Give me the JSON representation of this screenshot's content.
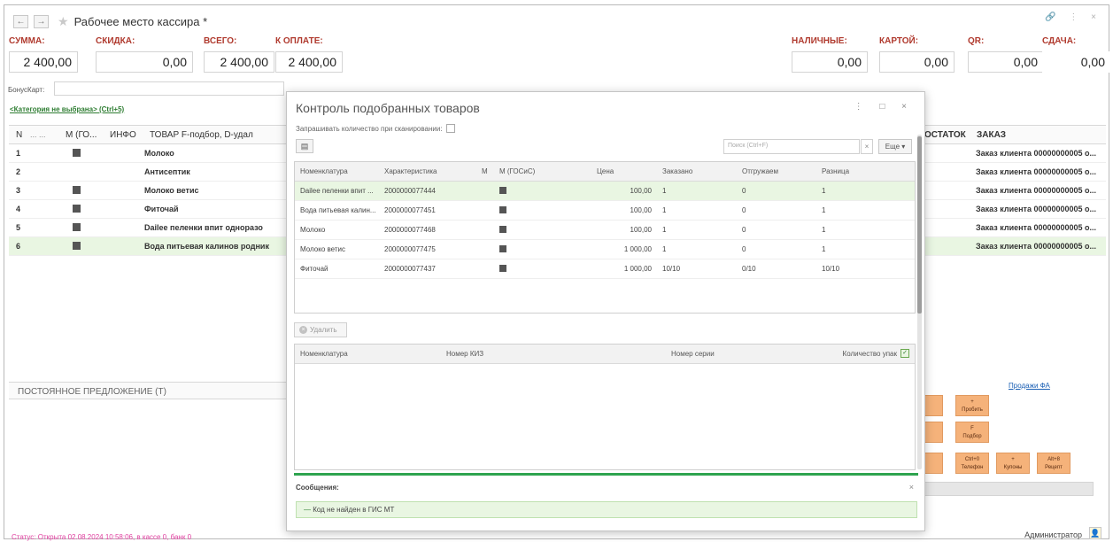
{
  "window": {
    "title": "Рабочее место кассира *"
  },
  "totals": {
    "summa_label": "СУММА:",
    "summa": "2 400,00",
    "skidka_label": "СКИДКА:",
    "skidka": "0,00",
    "vsego_label": "ВСЕГО:",
    "vsego": "2 400,00",
    "k_oplate_label": "К ОПЛАТЕ:",
    "k_oplate": "2 400,00",
    "nalichnye_label": "НАЛИЧНЫЕ:",
    "nalichnye": "0,00",
    "kartoy_label": "КАРТОЙ:",
    "kartoy": "0,00",
    "qr_label": "QR:",
    "qr": "0,00",
    "sdacha_label": "СДАЧА:",
    "sdacha": "0,00"
  },
  "bonus_label": "БонусКарт:",
  "category_link": "<Категория не выбрана> (Ctrl+5)",
  "bg_table": {
    "headers": {
      "n": "N",
      "dots": "...  ...",
      "m_gos": "М (ГО...",
      "info": "ИНФО",
      "tovar": "ТОВАР  F-подбор, D-удал"
    },
    "rows": [
      {
        "n": "1",
        "name": "Молоко"
      },
      {
        "n": "2",
        "name": "Антисептик"
      },
      {
        "n": "3",
        "name": "Молоко ветис"
      },
      {
        "n": "4",
        "name": "Фиточай"
      },
      {
        "n": "5",
        "name": "Dailee пеленки впит одноразо"
      },
      {
        "n": "6",
        "name": "Вода питьевая калинов родник"
      }
    ]
  },
  "right_table": {
    "headers": {
      "ostatok": "ОСТАТОК",
      "zakaz": "ЗАКАЗ"
    },
    "rows": [
      "Заказ клиента 00000000005 о...",
      "Заказ клиента 00000000005 о...",
      "Заказ клиента 00000000005 о...",
      "Заказ клиента 00000000005 о...",
      "Заказ клиента 00000000005 о...",
      "Заказ клиента 00000000005 о..."
    ]
  },
  "section_label": "ПОСТОЯННОЕ ПРЕДЛОЖЕНИЕ (Т)",
  "sales_link": "Продажи ФА",
  "action_buttons": [
    {
      "line1": "+",
      "line2": "Пробить"
    },
    {
      "line1": "F",
      "line2": "Подбор"
    },
    {
      "line1": "Ctrl+0",
      "line2": "Телефон"
    },
    {
      "line1": "+",
      "line2": "Купоны"
    },
    {
      "line1": "Alt+8",
      "line2": "Рецепт"
    }
  ],
  "status_bar": "Статус: Открыта 02.08.2024 10:58:06, в кассе 0, банк 0",
  "user": "Администратор",
  "dialog": {
    "title": "Контроль подобранных товаров",
    "ask_qty_label": "Запрашивать количество при сканировании:",
    "search_placeholder": "Поиск (Ctrl+F)",
    "more_label": "Еще",
    "top_headers": {
      "nom": "Номенклатура",
      "har": "Характеристика",
      "m": "М",
      "mgos": "М (ГОСиС)",
      "price": "Цена",
      "ordered": "Заказано",
      "shipped": "Отгружаем",
      "diff": "Разница"
    },
    "top_rows": [
      {
        "nom": "Dailee пеленки впит ...",
        "har": "2000000077444",
        "price": "100,00",
        "ordered": "1",
        "shipped": "0",
        "diff": "1"
      },
      {
        "nom": "Вода питьевая калин...",
        "har": "2000000077451",
        "price": "100,00",
        "ordered": "1",
        "shipped": "0",
        "diff": "1"
      },
      {
        "nom": "Молоко",
        "har": "2000000077468",
        "price": "100,00",
        "ordered": "1",
        "shipped": "0",
        "diff": "1"
      },
      {
        "nom": "Молоко ветис",
        "har": "2000000077475",
        "price": "1 000,00",
        "ordered": "1",
        "shipped": "0",
        "diff": "1"
      },
      {
        "nom": "Фиточай",
        "har": "2000000077437",
        "price": "1 000,00",
        "ordered": "10/10",
        "shipped": "0/10",
        "diff": "10/10"
      }
    ],
    "delete_label": "Удалить",
    "bottom_headers": {
      "nom": "Номенклатура",
      "kiz": "Номер КИЗ",
      "series": "Номер серии",
      "qty": "Количество упак"
    },
    "messages_title": "Сообщения:",
    "message": "Код не найден в ГИС МТ"
  }
}
